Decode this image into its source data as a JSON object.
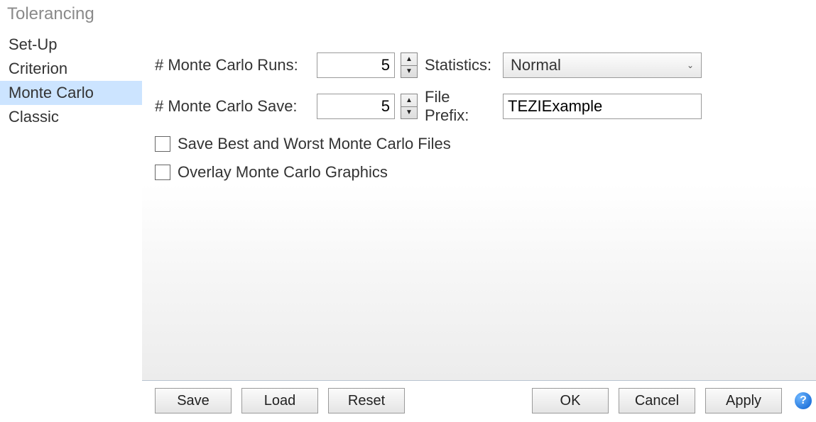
{
  "title": "Tolerancing",
  "sidebar": {
    "items": [
      {
        "label": "Set-Up"
      },
      {
        "label": "Criterion"
      },
      {
        "label": "Monte Carlo"
      },
      {
        "label": "Classic"
      }
    ],
    "selected_index": 2
  },
  "form": {
    "runs_label": "# Monte Carlo Runs:",
    "runs_value": "5",
    "statistics_label": "Statistics:",
    "statistics_value": "Normal",
    "save_label": "# Monte Carlo Save:",
    "save_value": "5",
    "file_prefix_label": "File Prefix:",
    "file_prefix_value": "TEZIExample",
    "checkbox_best_worst": "Save Best and Worst Monte Carlo Files",
    "checkbox_overlay": "Overlay Monte Carlo Graphics"
  },
  "buttons": {
    "save": "Save",
    "load": "Load",
    "reset": "Reset",
    "ok": "OK",
    "cancel": "Cancel",
    "apply": "Apply",
    "help": "?"
  }
}
